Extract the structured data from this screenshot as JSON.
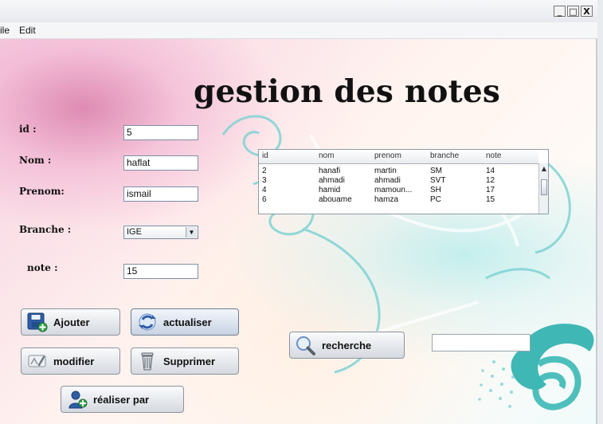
{
  "window": {
    "minimize": "_",
    "maximize": "□",
    "close": "X"
  },
  "menu": {
    "file": "ile",
    "edit": "Edit"
  },
  "title": "gestion des notes",
  "form": {
    "id_label": "id :",
    "id_value": "5",
    "nom_label": "Nom :",
    "nom_value": "haflat",
    "prenom_label": "Prenom:",
    "prenom_value": "ismail",
    "branche_label": "Branche :",
    "branche_value": "IGE",
    "note_label": "note :",
    "note_value": "15"
  },
  "table": {
    "headers": [
      "id",
      "nom",
      "prenom",
      "branche",
      "note"
    ],
    "rows": [
      [
        "2",
        "hanafi",
        "martin",
        "SM",
        "14"
      ],
      [
        "3",
        "ahmadi",
        "ahmadi",
        "SVT",
        "12"
      ],
      [
        "4",
        "hamid",
        "mamoun...",
        "SH",
        "17"
      ],
      [
        "6",
        "abouame",
        "hamza",
        "PC",
        "15"
      ]
    ]
  },
  "buttons": {
    "ajouter": "Ajouter",
    "actualiser": "actualiser",
    "modifier": "modifier",
    "supprimer": "Supprimer",
    "recherche": "recherche",
    "realiser": "réaliser par"
  },
  "search": {
    "value": ""
  },
  "icons": {
    "ajouter": "floppy-add-icon",
    "actualiser": "refresh-icon",
    "modifier": "edit-icon",
    "supprimer": "trash-icon",
    "recherche": "magnifier-icon",
    "realiser": "user-add-icon"
  },
  "colors": {
    "accent": "#2d5fa8",
    "teal": "#5cc9c8",
    "pink": "#d774a4"
  }
}
